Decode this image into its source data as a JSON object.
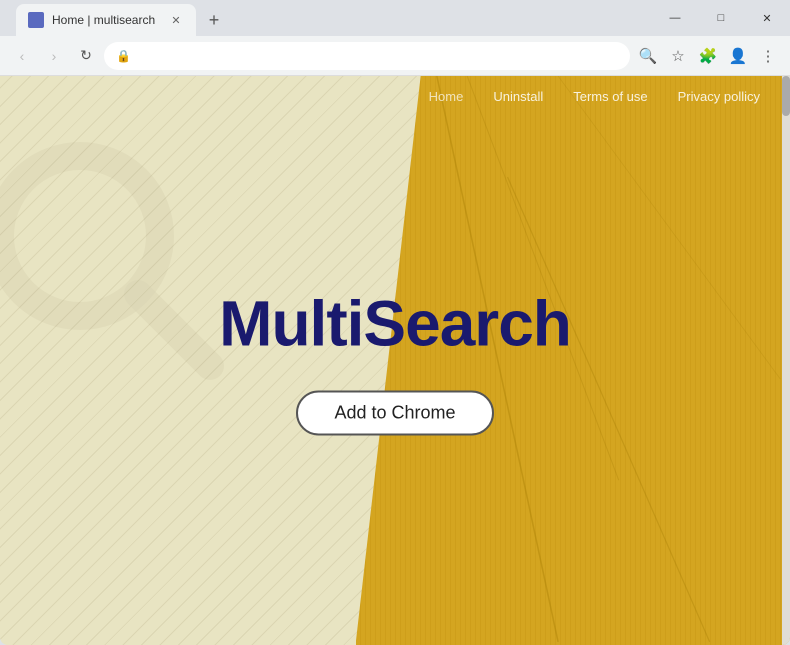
{
  "browser": {
    "tab_title": "Home | multisearch",
    "tab_favicon_label": "M",
    "new_tab_icon": "+",
    "window_minimize": "—",
    "window_maximize": "□",
    "window_close": "✕",
    "address": "",
    "nav": {
      "back_disabled": true,
      "forward_disabled": true,
      "refresh_label": "↻",
      "back_label": "←",
      "forward_label": "→"
    },
    "toolbar": {
      "search_icon": "🔍",
      "star_icon": "☆",
      "extensions_icon": "🧩",
      "profile_icon": "👤",
      "menu_icon": "⋮"
    }
  },
  "site": {
    "nav_links": [
      {
        "label": "Home",
        "class": "home"
      },
      {
        "label": "Uninstall",
        "class": ""
      },
      {
        "label": "Terms of use",
        "class": ""
      },
      {
        "label": "Privacy pollicy",
        "class": ""
      }
    ],
    "brand_name_part1": "Multi",
    "brand_name_part2": "Search",
    "cta_button_label": "Add to Chrome",
    "colors": {
      "left_bg": "#e8e4c2",
      "right_bg": "#d4a520",
      "brand_color": "#1a1a6e",
      "btn_border": "#555555"
    }
  }
}
